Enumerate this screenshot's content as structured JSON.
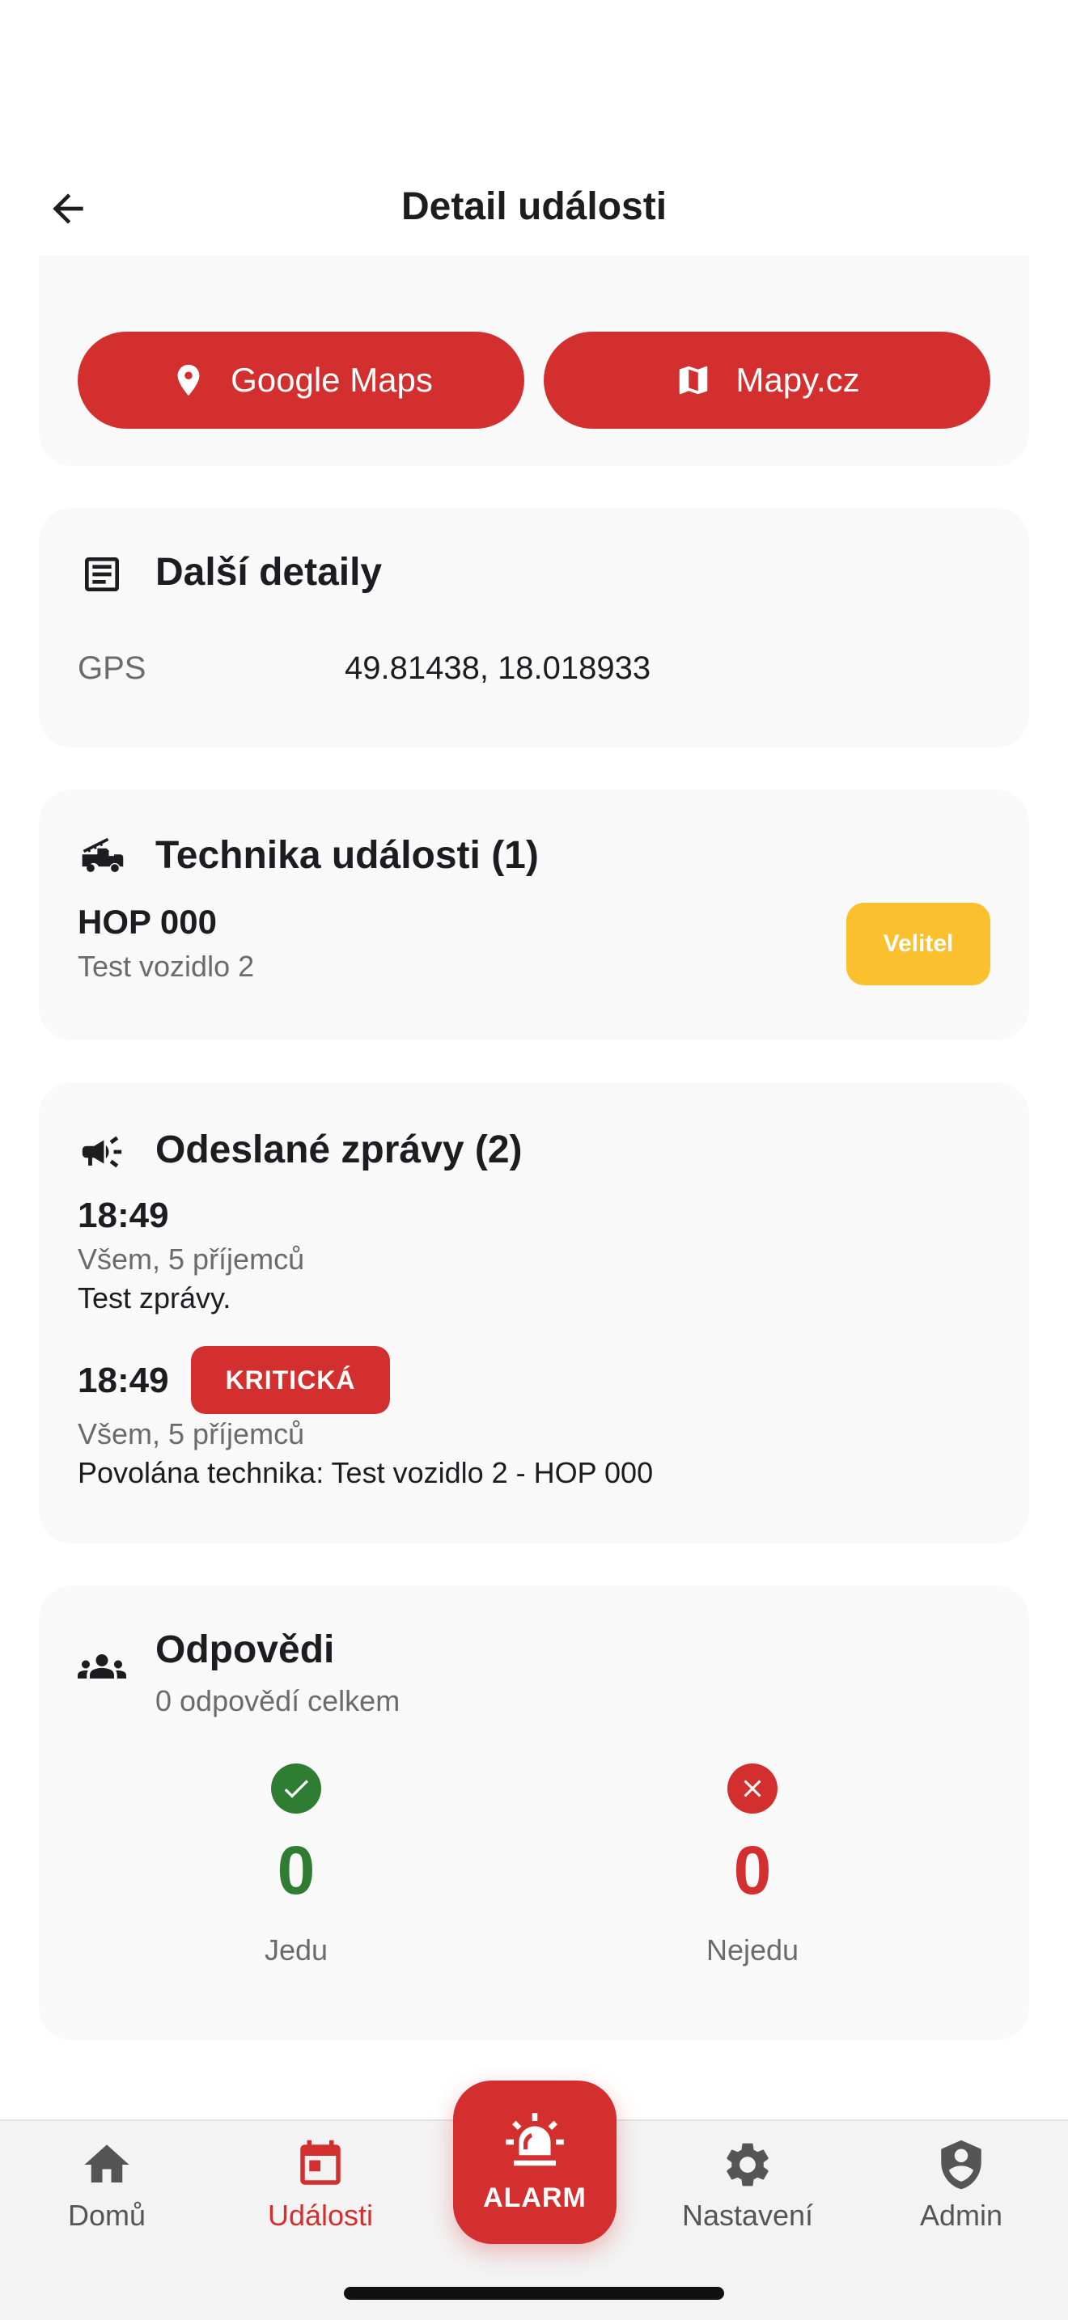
{
  "header": {
    "title": "Detail události"
  },
  "maps": {
    "google": "Google Maps",
    "mapy": "Mapy.cz"
  },
  "details": {
    "title": "Další detaily",
    "gps_label": "GPS",
    "gps_value": "49.81438, 18.018933"
  },
  "technika": {
    "title": "Technika události (1)",
    "vehicle": {
      "name": "HOP 000",
      "description": "Test vozidlo 2",
      "role": "Velitel"
    }
  },
  "messages": {
    "title": "Odeslané zprávy (2)",
    "items": [
      {
        "time": "18:49",
        "recipients": "Všem, 5 příjemců",
        "text": "Test zprávy."
      },
      {
        "time": "18:49",
        "badge": "KRITICKÁ",
        "recipients": "Všem, 5 příjemců",
        "text": "Povolána technika: Test vozidlo 2 - HOP 000"
      }
    ]
  },
  "responses": {
    "title": "Odpovědi",
    "subtitle": "0 odpovědí celkem",
    "going": {
      "count": "0",
      "label": "Jedu"
    },
    "not_going": {
      "count": "0",
      "label": "Nejedu"
    }
  },
  "nav": {
    "home": "Domů",
    "events": "Události",
    "alarm": "ALARM",
    "settings": "Nastavení",
    "admin": "Admin",
    "active": "events"
  },
  "colors": {
    "primary": "#d32f2f",
    "warning": "#fbc02d",
    "success": "#2e7d32",
    "card": "#f9f9f9"
  },
  "icons": {
    "back": "arrow-left-icon",
    "google_maps": "map-pin-icon",
    "mapy": "map-icon",
    "details": "document-icon",
    "technika": "fire-truck-icon",
    "messages": "megaphone-icon",
    "responses": "group-icon",
    "going": "check-circle-icon",
    "not_going": "cancel-circle-icon",
    "home": "home-icon",
    "events": "calendar-icon",
    "alarm": "siren-icon",
    "settings": "gear-icon",
    "admin": "shield-user-icon"
  }
}
